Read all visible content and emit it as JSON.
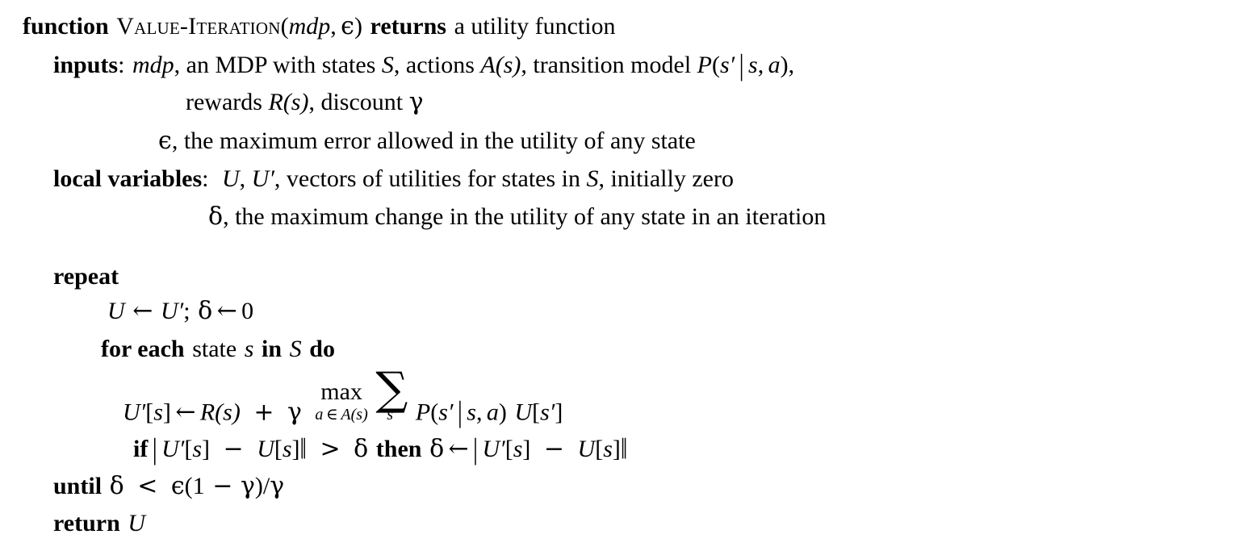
{
  "document": {
    "kind": "pseudocode-algorithm",
    "background_color": "#ffffff",
    "text_color": "#000000"
  },
  "algorithm": {
    "name": "VALUE-ITERATION",
    "header": {
      "keyword_function": "function",
      "name_smallcaps": "Value-Iteration",
      "open_paren": "(",
      "arg_mdp": "mdp",
      "arg_comma": ",",
      "arg_epsilon": "ϵ",
      "close_paren": ")",
      "keyword_returns": "returns",
      "return_description": "a utility function"
    },
    "inputs": {
      "label": "inputs",
      "colon": ":",
      "line1": {
        "mdp": "mdp",
        "text_a": ", an MDP with states ",
        "S": "S",
        "text_b": ", actions ",
        "A_of_s": "A(s)",
        "text_c": ", transition model ",
        "P_name": "P",
        "P_open": "(",
        "s_prime": "s′",
        "cond_bar": "|",
        "s": "s",
        "comma": ",",
        "a": "a",
        "P_close": ")",
        "trailing_comma": ","
      },
      "line2": {
        "text_a": "rewards ",
        "R_of_s": "R(s)",
        "text_b": ", discount ",
        "gamma": "γ"
      },
      "line3": {
        "epsilon": "ϵ",
        "text": ", the maximum error allowed in the utility of any state"
      }
    },
    "local_variables": {
      "label": "local variables",
      "colon": ":",
      "line1": {
        "U": "U",
        "comma1": ", ",
        "U_prime": "U′",
        "text_a": ", vectors of utilities for states in ",
        "S": "S",
        "text_b": ", initially zero"
      },
      "line2": {
        "delta": "δ",
        "text": ", the maximum change in the utility of any state in an iteration"
      }
    },
    "body": {
      "repeat": {
        "keyword": "repeat"
      },
      "init": {
        "U": "U",
        "arrow1": "←",
        "U_prime": "U′",
        "semicolon": ";",
        "delta": "δ",
        "arrow2": "←",
        "zero": "0"
      },
      "foreach": {
        "keyword_for_each": "for each",
        "text_state": "state",
        "s": "s",
        "keyword_in": "in",
        "S": "S",
        "keyword_do": "do"
      },
      "bellman_update": {
        "U_prime": "U′",
        "index_open": "[",
        "s": "s",
        "index_close": "]",
        "arrow": "←",
        "R_of_s": "R(s)",
        "plus": "+",
        "gamma": "γ",
        "max_op": "max",
        "max_limit_a": "a",
        "max_limit_in": "∈",
        "max_limit_A": "A(s)",
        "sum_op": "∑",
        "sum_limit": "s′",
        "P_name": "P",
        "P_open": "(",
        "P_s_prime": "s′",
        "P_bar": "|",
        "P_s": "s",
        "P_comma": ",",
        "P_a": "a",
        "P_close": ")",
        "U": "U",
        "U_open": "[",
        "U_s_prime": "s′",
        "U_close": "]"
      },
      "if_statement": {
        "keyword_if": "if",
        "bar_open": "|",
        "lhs_U_prime": "U′",
        "lhs_open": "[",
        "lhs_s": "s",
        "lhs_close": "]",
        "minus": "−",
        "rhs_U": "U",
        "rhs_open": "[",
        "rhs_s": "s",
        "rhs_close": "]",
        "bar_close": "‖",
        "gt": ">",
        "delta": "δ",
        "keyword_then": "then",
        "assign_delta": "δ",
        "arrow": "←",
        "abs2_open": "|",
        "abs2_U_prime": "U′",
        "abs2_lopen": "[",
        "abs2_ls": "s",
        "abs2_lclose": "]",
        "abs2_minus": "−",
        "abs2_U": "U",
        "abs2_ropen": "[",
        "abs2_rs": "s",
        "abs2_rclose": "]",
        "abs2_close": "‖"
      },
      "until_statement": {
        "keyword": "until",
        "delta": "δ",
        "lt": "<",
        "epsilon": "ϵ",
        "open": "(",
        "one": "1",
        "minus": "−",
        "gamma": "γ",
        "close": ")",
        "slash": "/",
        "gamma2": "γ"
      },
      "return_statement": {
        "keyword": "return",
        "value": "U"
      }
    }
  }
}
